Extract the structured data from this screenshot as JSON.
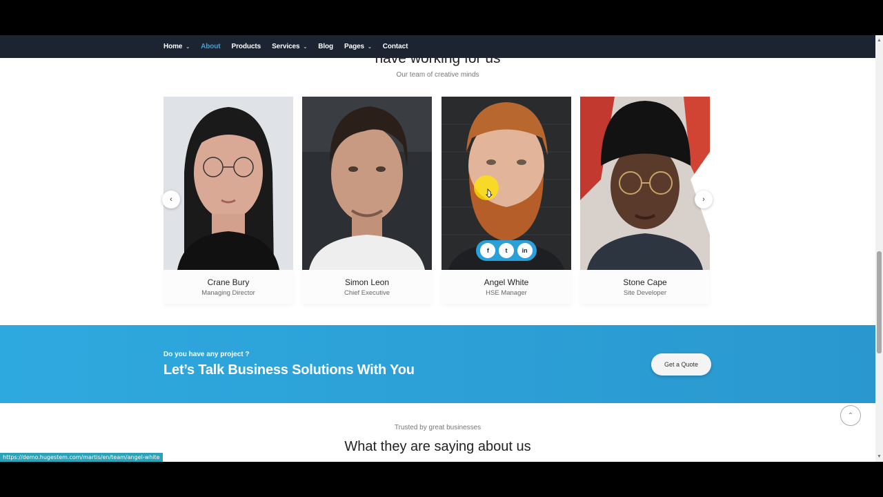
{
  "nav": {
    "items": [
      {
        "label": "Home",
        "has_dropdown": true,
        "active": false
      },
      {
        "label": "About",
        "has_dropdown": false,
        "active": true
      },
      {
        "label": "Products",
        "has_dropdown": false,
        "active": false
      },
      {
        "label": "Services",
        "has_dropdown": true,
        "active": false
      },
      {
        "label": "Blog",
        "has_dropdown": false,
        "active": false
      },
      {
        "label": "Pages",
        "has_dropdown": true,
        "active": false
      },
      {
        "label": "Contact",
        "has_dropdown": false,
        "active": false
      }
    ]
  },
  "team": {
    "heading": "have working for us",
    "subheading": "Our team of creative minds",
    "members": [
      {
        "name": "Crane Bury",
        "role": "Managing Director"
      },
      {
        "name": "Simon Leon",
        "role": "Chief Executive"
      },
      {
        "name": "Angel White",
        "role": "HSE Manager"
      },
      {
        "name": "Stone Cape",
        "role": "Site Developer"
      }
    ],
    "social_icons": [
      "facebook-icon",
      "twitter-icon",
      "linkedin-icon"
    ],
    "social_glyphs": [
      "f",
      "t",
      "in"
    ]
  },
  "cta": {
    "kicker": "Do you have any project ?",
    "title": "Let’s Talk Business Solutions With You",
    "button": "Get a Quote"
  },
  "testimonials": {
    "kicker": "Trusted by great businesses",
    "heading": "What they are saying about us"
  },
  "status_bar": {
    "url": "https://demo.hugestem.com/martis/en/team/angel-white"
  },
  "colors": {
    "nav_bg": "#1c2331",
    "accent": "#2eaae1",
    "cta_bg": "#2ea9df"
  }
}
